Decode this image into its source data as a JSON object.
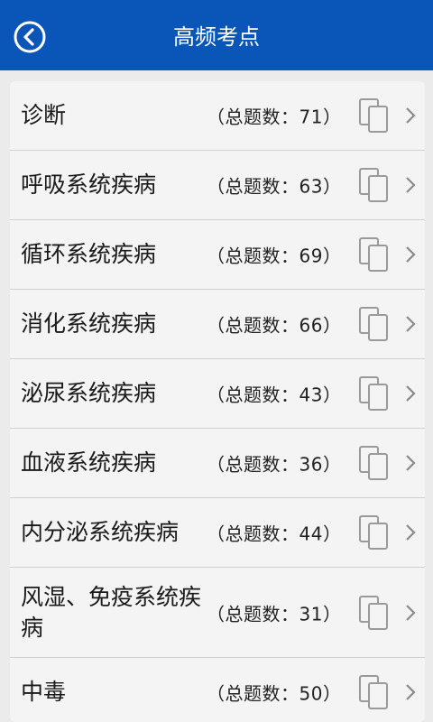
{
  "header": {
    "title": "高频考点",
    "back_icon": "back-arrow-circle-icon"
  },
  "list": {
    "items": [
      {
        "name": "诊断",
        "count": "（总题数：71）"
      },
      {
        "name": "呼吸系统疾病",
        "count": "（总题数：63）"
      },
      {
        "name": "循环系统疾病",
        "count": "（总题数：69）"
      },
      {
        "name": "消化系统疾病",
        "count": "（总题数：66）"
      },
      {
        "name": "泌尿系统疾病",
        "count": "（总题数：43）"
      },
      {
        "name": "血液系统疾病",
        "count": "（总题数：36）"
      },
      {
        "name": "内分泌系统疾病",
        "count": "（总题数：44）"
      },
      {
        "name": "风湿、免疫系统疾病",
        "count": "（总题数：31）"
      },
      {
        "name": "中毒",
        "count": "（总题数：50）"
      }
    ]
  },
  "colors": {
    "header_bg": "#0a56b8",
    "page_bg": "#ebebeb",
    "list_bg": "#f4f4f4"
  }
}
